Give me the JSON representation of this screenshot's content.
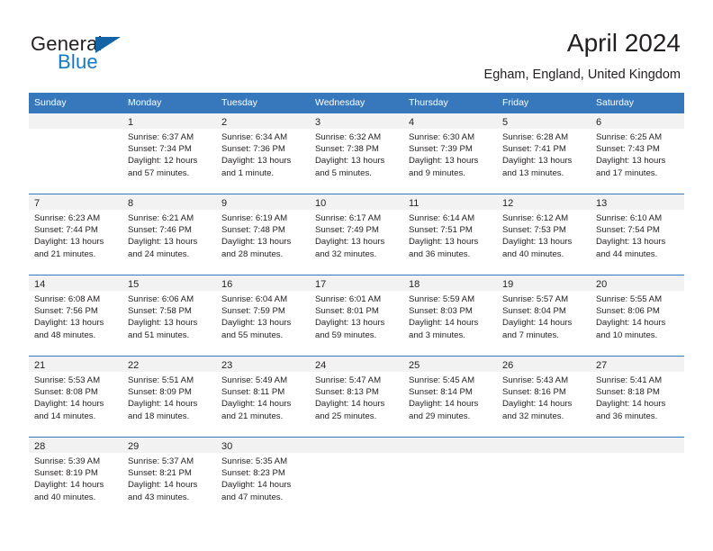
{
  "brand": {
    "name_top": "General",
    "name_bottom": "Blue",
    "accent_color": "#1479c4",
    "triangle_color": "#1464a5",
    "logo_icon": "blue-triangle-icon"
  },
  "header": {
    "title": "April 2024",
    "subtitle": "Egham, England, United Kingdom"
  },
  "calendar": {
    "header_bg": "#3778bc",
    "day_band_bg": "#f2f2f2",
    "weekdays": [
      "Sunday",
      "Monday",
      "Tuesday",
      "Wednesday",
      "Thursday",
      "Friday",
      "Saturday"
    ],
    "weeks": [
      [
        {
          "day": "",
          "lines": []
        },
        {
          "day": "1",
          "lines": [
            "Sunrise: 6:37 AM",
            "Sunset: 7:34 PM",
            "Daylight: 12 hours",
            "and 57 minutes."
          ]
        },
        {
          "day": "2",
          "lines": [
            "Sunrise: 6:34 AM",
            "Sunset: 7:36 PM",
            "Daylight: 13 hours",
            "and 1 minute."
          ]
        },
        {
          "day": "3",
          "lines": [
            "Sunrise: 6:32 AM",
            "Sunset: 7:38 PM",
            "Daylight: 13 hours",
            "and 5 minutes."
          ]
        },
        {
          "day": "4",
          "lines": [
            "Sunrise: 6:30 AM",
            "Sunset: 7:39 PM",
            "Daylight: 13 hours",
            "and 9 minutes."
          ]
        },
        {
          "day": "5",
          "lines": [
            "Sunrise: 6:28 AM",
            "Sunset: 7:41 PM",
            "Daylight: 13 hours",
            "and 13 minutes."
          ]
        },
        {
          "day": "6",
          "lines": [
            "Sunrise: 6:25 AM",
            "Sunset: 7:43 PM",
            "Daylight: 13 hours",
            "and 17 minutes."
          ]
        }
      ],
      [
        {
          "day": "7",
          "lines": [
            "Sunrise: 6:23 AM",
            "Sunset: 7:44 PM",
            "Daylight: 13 hours",
            "and 21 minutes."
          ]
        },
        {
          "day": "8",
          "lines": [
            "Sunrise: 6:21 AM",
            "Sunset: 7:46 PM",
            "Daylight: 13 hours",
            "and 24 minutes."
          ]
        },
        {
          "day": "9",
          "lines": [
            "Sunrise: 6:19 AM",
            "Sunset: 7:48 PM",
            "Daylight: 13 hours",
            "and 28 minutes."
          ]
        },
        {
          "day": "10",
          "lines": [
            "Sunrise: 6:17 AM",
            "Sunset: 7:49 PM",
            "Daylight: 13 hours",
            "and 32 minutes."
          ]
        },
        {
          "day": "11",
          "lines": [
            "Sunrise: 6:14 AM",
            "Sunset: 7:51 PM",
            "Daylight: 13 hours",
            "and 36 minutes."
          ]
        },
        {
          "day": "12",
          "lines": [
            "Sunrise: 6:12 AM",
            "Sunset: 7:53 PM",
            "Daylight: 13 hours",
            "and 40 minutes."
          ]
        },
        {
          "day": "13",
          "lines": [
            "Sunrise: 6:10 AM",
            "Sunset: 7:54 PM",
            "Daylight: 13 hours",
            "and 44 minutes."
          ]
        }
      ],
      [
        {
          "day": "14",
          "lines": [
            "Sunrise: 6:08 AM",
            "Sunset: 7:56 PM",
            "Daylight: 13 hours",
            "and 48 minutes."
          ]
        },
        {
          "day": "15",
          "lines": [
            "Sunrise: 6:06 AM",
            "Sunset: 7:58 PM",
            "Daylight: 13 hours",
            "and 51 minutes."
          ]
        },
        {
          "day": "16",
          "lines": [
            "Sunrise: 6:04 AM",
            "Sunset: 7:59 PM",
            "Daylight: 13 hours",
            "and 55 minutes."
          ]
        },
        {
          "day": "17",
          "lines": [
            "Sunrise: 6:01 AM",
            "Sunset: 8:01 PM",
            "Daylight: 13 hours",
            "and 59 minutes."
          ]
        },
        {
          "day": "18",
          "lines": [
            "Sunrise: 5:59 AM",
            "Sunset: 8:03 PM",
            "Daylight: 14 hours",
            "and 3 minutes."
          ]
        },
        {
          "day": "19",
          "lines": [
            "Sunrise: 5:57 AM",
            "Sunset: 8:04 PM",
            "Daylight: 14 hours",
            "and 7 minutes."
          ]
        },
        {
          "day": "20",
          "lines": [
            "Sunrise: 5:55 AM",
            "Sunset: 8:06 PM",
            "Daylight: 14 hours",
            "and 10 minutes."
          ]
        }
      ],
      [
        {
          "day": "21",
          "lines": [
            "Sunrise: 5:53 AM",
            "Sunset: 8:08 PM",
            "Daylight: 14 hours",
            "and 14 minutes."
          ]
        },
        {
          "day": "22",
          "lines": [
            "Sunrise: 5:51 AM",
            "Sunset: 8:09 PM",
            "Daylight: 14 hours",
            "and 18 minutes."
          ]
        },
        {
          "day": "23",
          "lines": [
            "Sunrise: 5:49 AM",
            "Sunset: 8:11 PM",
            "Daylight: 14 hours",
            "and 21 minutes."
          ]
        },
        {
          "day": "24",
          "lines": [
            "Sunrise: 5:47 AM",
            "Sunset: 8:13 PM",
            "Daylight: 14 hours",
            "and 25 minutes."
          ]
        },
        {
          "day": "25",
          "lines": [
            "Sunrise: 5:45 AM",
            "Sunset: 8:14 PM",
            "Daylight: 14 hours",
            "and 29 minutes."
          ]
        },
        {
          "day": "26",
          "lines": [
            "Sunrise: 5:43 AM",
            "Sunset: 8:16 PM",
            "Daylight: 14 hours",
            "and 32 minutes."
          ]
        },
        {
          "day": "27",
          "lines": [
            "Sunrise: 5:41 AM",
            "Sunset: 8:18 PM",
            "Daylight: 14 hours",
            "and 36 minutes."
          ]
        }
      ],
      [
        {
          "day": "28",
          "lines": [
            "Sunrise: 5:39 AM",
            "Sunset: 8:19 PM",
            "Daylight: 14 hours",
            "and 40 minutes."
          ]
        },
        {
          "day": "29",
          "lines": [
            "Sunrise: 5:37 AM",
            "Sunset: 8:21 PM",
            "Daylight: 14 hours",
            "and 43 minutes."
          ]
        },
        {
          "day": "30",
          "lines": [
            "Sunrise: 5:35 AM",
            "Sunset: 8:23 PM",
            "Daylight: 14 hours",
            "and 47 minutes."
          ]
        },
        {
          "day": "",
          "lines": []
        },
        {
          "day": "",
          "lines": []
        },
        {
          "day": "",
          "lines": []
        },
        {
          "day": "",
          "lines": []
        }
      ]
    ]
  }
}
